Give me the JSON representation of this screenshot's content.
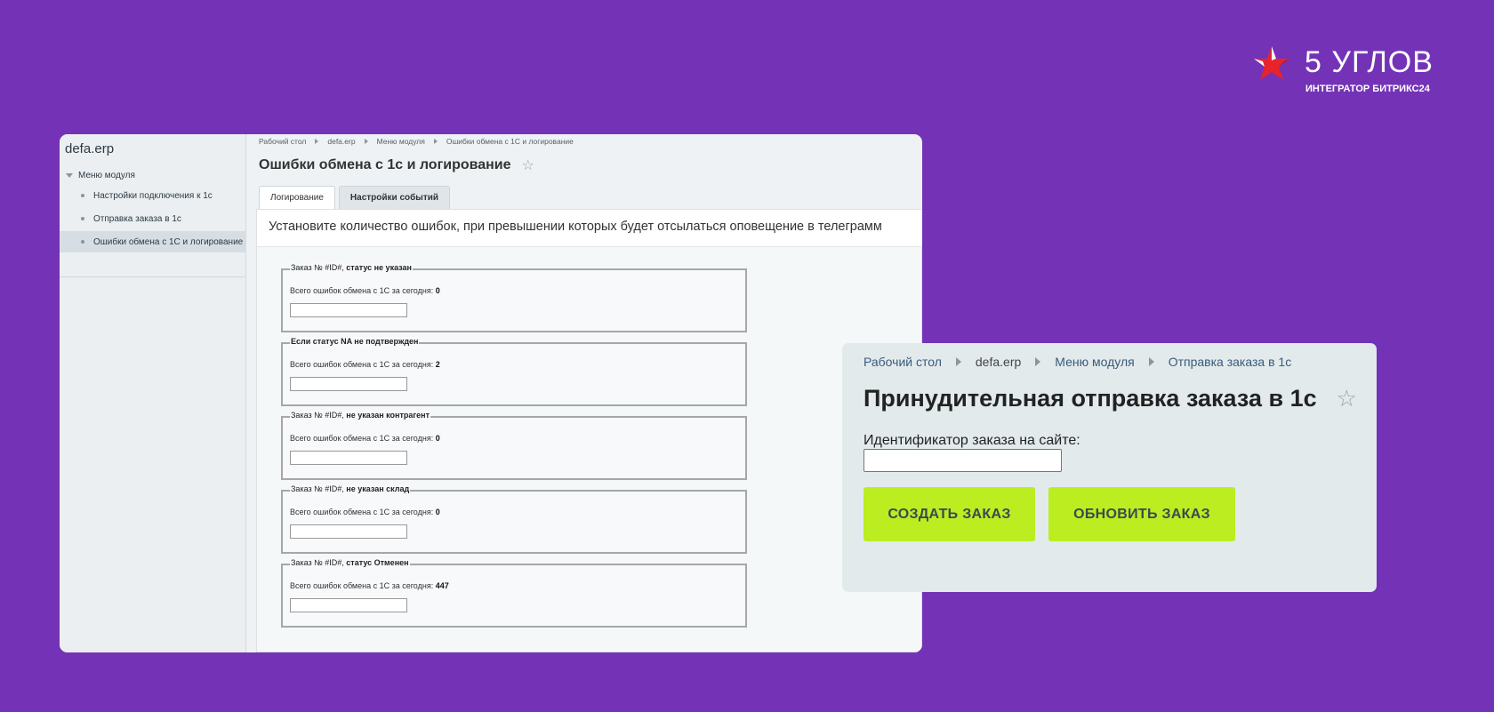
{
  "logo": {
    "title": "5 УГЛОВ",
    "subtitle": "ИНТЕГРАТОР БИТРИКС24",
    "mark_icon": "star-logo-icon",
    "mark_color": "#e8232a"
  },
  "left_panel": {
    "sidebar": {
      "title": "defa.erp",
      "menu_label": "Меню модуля",
      "items": [
        {
          "label": "Настройки подключения к 1с"
        },
        {
          "label": "Отправка заказа в 1с"
        },
        {
          "label": "Ошибки обмена с 1С и логирование",
          "active": true
        }
      ]
    },
    "breadcrumb": [
      "Рабочий стол",
      "defa.erp",
      "Меню модуля",
      "Ошибки обмена с 1С и логирование"
    ],
    "page_title": "Ошибки обмена с 1с и логирование",
    "tabs": [
      {
        "label": "Логирование",
        "active": true
      },
      {
        "label": "Настройки событий",
        "active": false
      }
    ],
    "notice": "Установите количество ошибок, при превышении которых будет отсылаться оповещение в телеграмм",
    "groups": [
      {
        "legend_prefix": "Заказ № #ID#, ",
        "legend_bold": "статус не указан",
        "line_label": "Всего ошибок обмена с 1С за сегодня: ",
        "count": "0",
        "input_value": ""
      },
      {
        "legend_prefix": "",
        "legend_bold": "Если статус NA не подтвержден",
        "line_label": "Всего ошибок обмена с 1С за сегодня: ",
        "count": "2",
        "input_value": ""
      },
      {
        "legend_prefix": "Заказ № #ID#, ",
        "legend_bold": "не указан контрагент",
        "line_label": "Всего ошибок обмена с 1С за сегодня: ",
        "count": "0",
        "input_value": ""
      },
      {
        "legend_prefix": "Заказ № #ID#, ",
        "legend_bold": "не указан склад",
        "line_label": "Всего ошибок обмена с 1С за сегодня: ",
        "count": "0",
        "input_value": ""
      },
      {
        "legend_prefix": "Заказ № #ID#, ",
        "legend_bold": "статус Отменен",
        "line_label": "Всего ошибок обмена с 1С за сегодня: ",
        "count": "447",
        "input_value": ""
      }
    ]
  },
  "right_panel": {
    "breadcrumb": [
      "Рабочий стол",
      "defa.erp",
      "Меню модуля",
      "Отправка заказа в 1с"
    ],
    "page_title": "Принудительная отправка заказа в 1с",
    "field_label": "Идентификатор заказа на сайте:",
    "field_value": "",
    "create_button": "СОЗДАТЬ ЗАКАЗ",
    "update_button": "ОБНОВИТЬ ЗАКАЗ",
    "button_color": "#bbed21"
  },
  "colors": {
    "background": "#7433b7"
  }
}
